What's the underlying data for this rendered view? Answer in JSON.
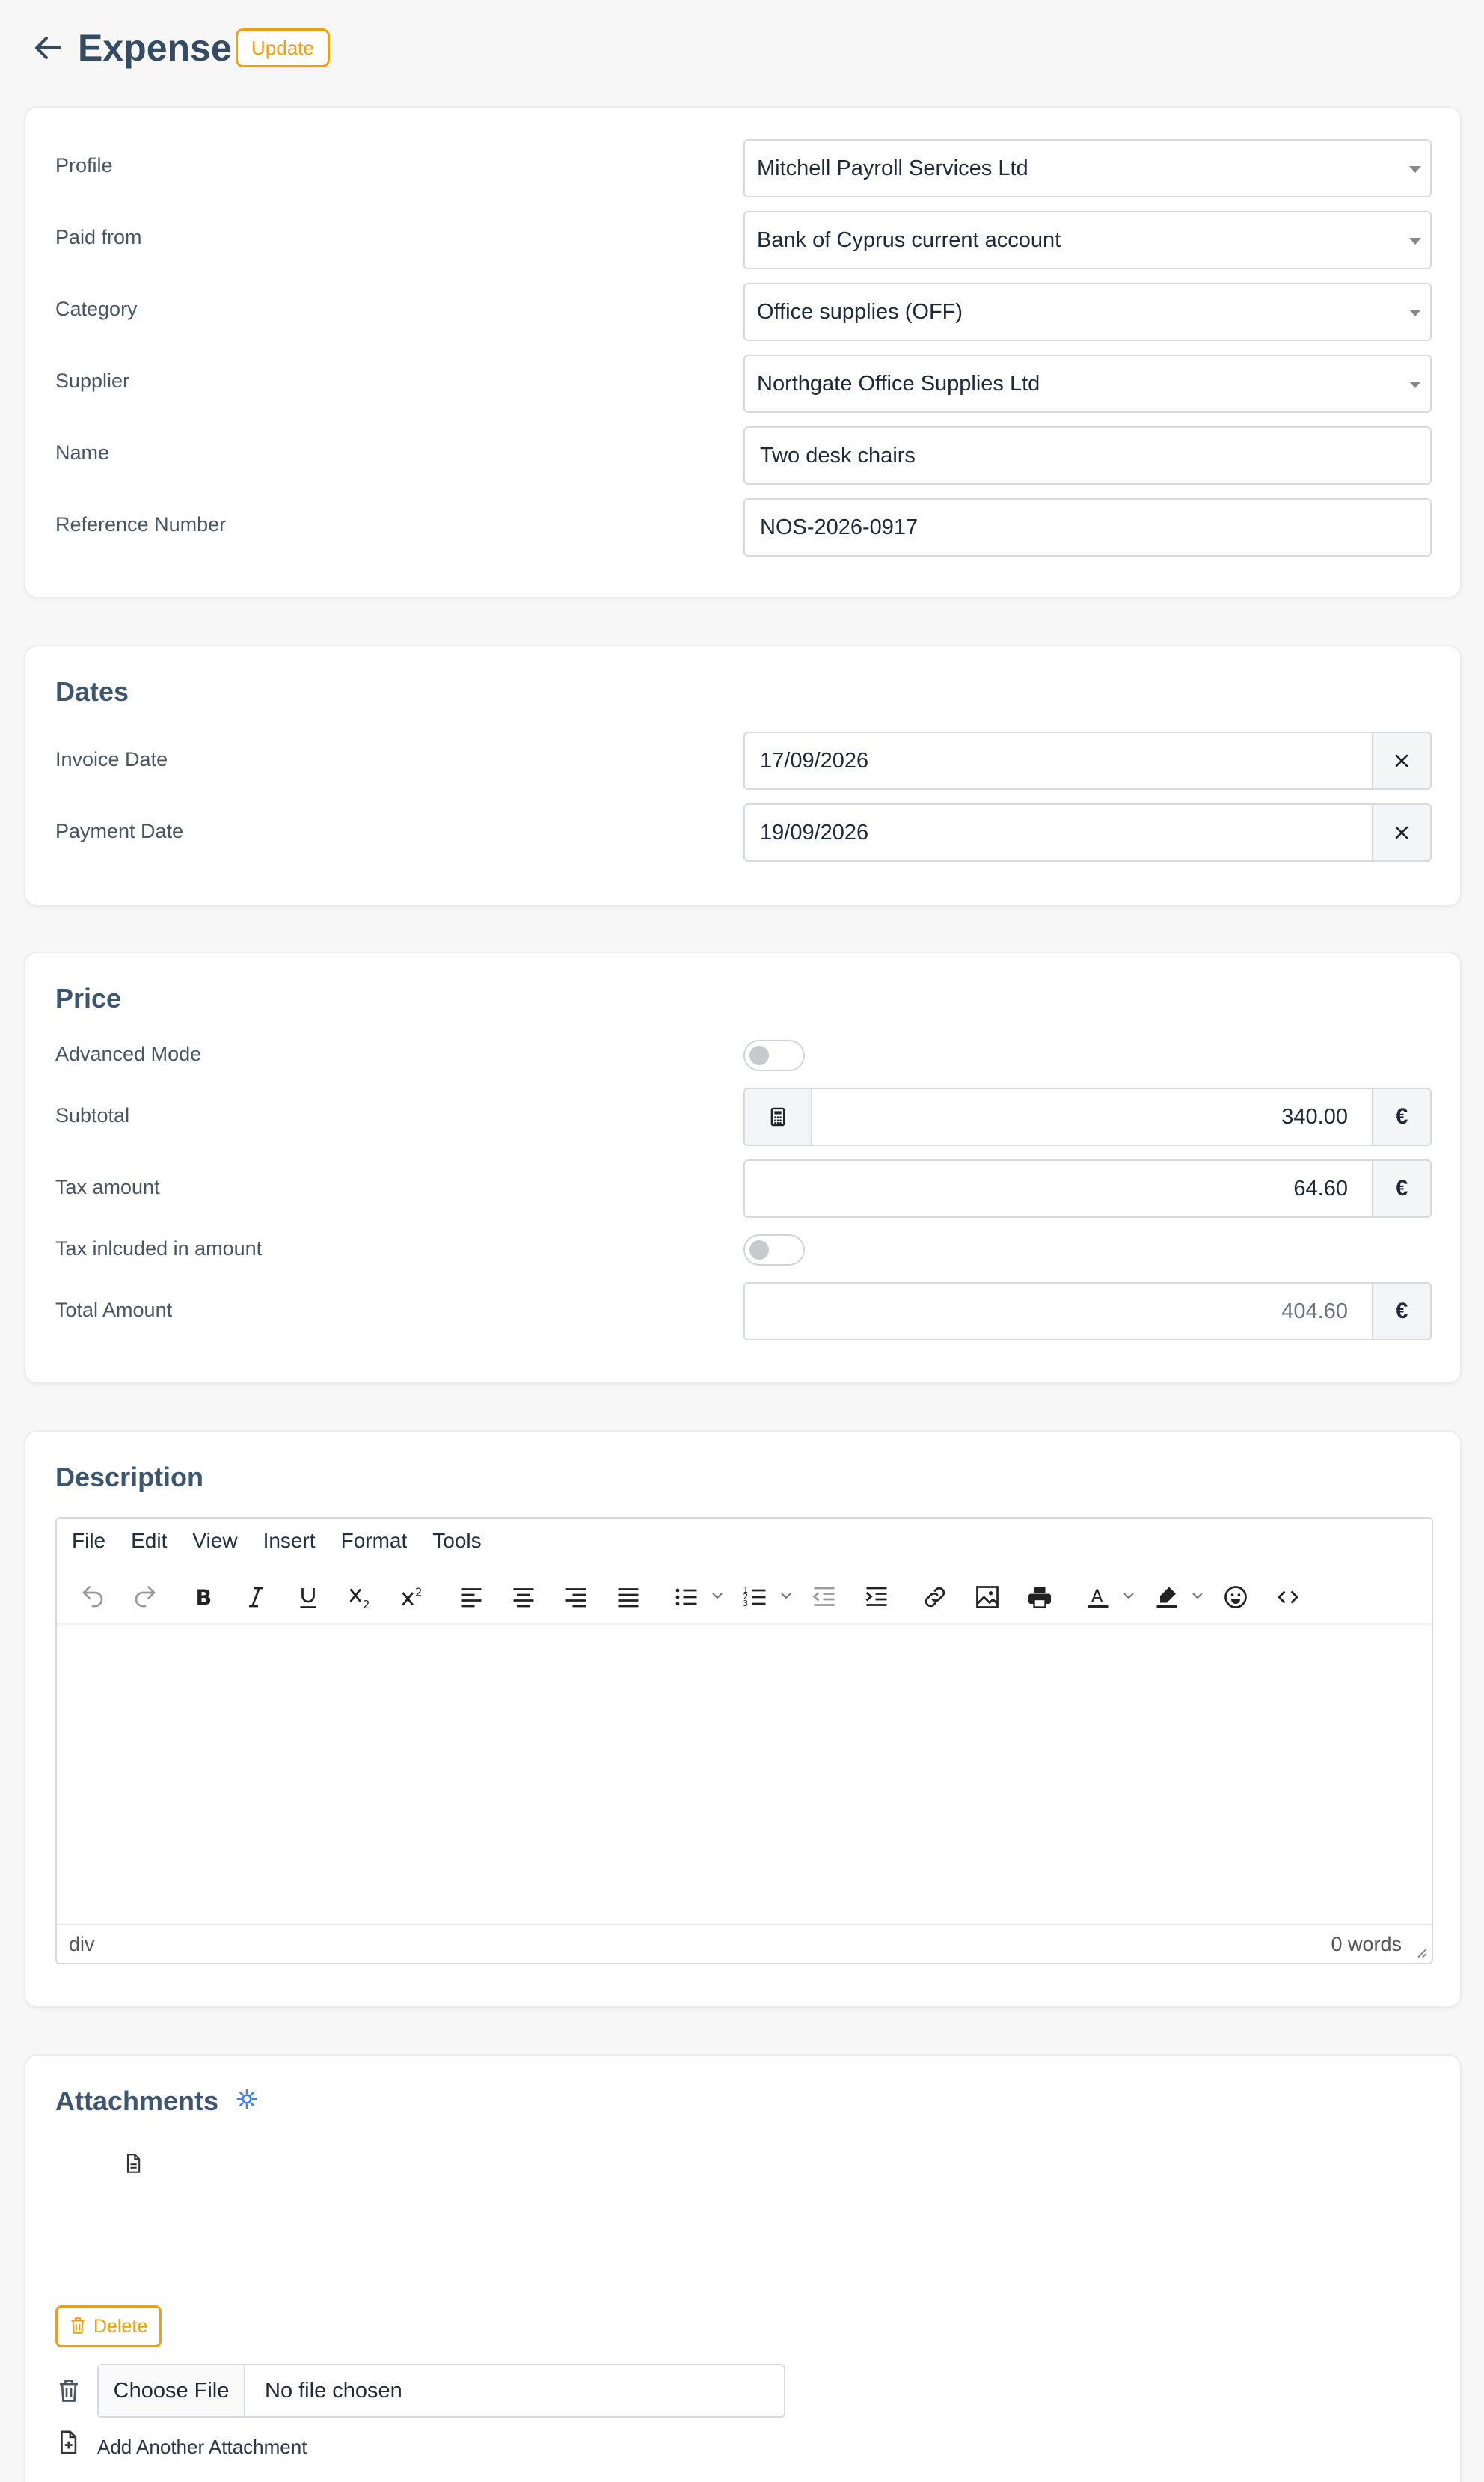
{
  "header": {
    "title": "Expense",
    "badge": "Update"
  },
  "details": {
    "rows": [
      {
        "label": "Profile",
        "value": "Mitchell Payroll Services Ltd",
        "type": "select"
      },
      {
        "label": "Paid from",
        "value": "Bank of Cyprus current account",
        "type": "select"
      },
      {
        "label": "Category",
        "value": "Office supplies (OFF)",
        "type": "select"
      },
      {
        "label": "Supplier",
        "value": "Northgate Office Supplies Ltd",
        "type": "select"
      },
      {
        "label": "Name",
        "value": "Two desk chairs",
        "type": "text"
      },
      {
        "label": "Reference Number",
        "value": "NOS-2026-0917",
        "type": "text"
      }
    ]
  },
  "dates": {
    "title": "Dates",
    "invoice_label": "Invoice Date",
    "invoice_value": "17/09/2026",
    "payment_label": "Payment Date",
    "payment_value": "19/09/2026"
  },
  "price": {
    "title": "Price",
    "advanced_label": "Advanced Mode",
    "advanced_on": false,
    "subtotal_label": "Subtotal",
    "subtotal_value": "340.00",
    "tax_label": "Tax amount",
    "tax_value": "64.60",
    "tax_included_label": "Tax inlcuded in amount",
    "tax_included_on": false,
    "total_label": "Total Amount",
    "total_value": "404.60",
    "currency": "€"
  },
  "description": {
    "title": "Description",
    "menu": [
      "File",
      "Edit",
      "View",
      "Insert",
      "Format",
      "Tools"
    ],
    "status_path": "div",
    "word_count": "0 words"
  },
  "attachments": {
    "title": "Attachments",
    "delete_label": "Delete",
    "choose_file_label": "Choose File",
    "no_file_label": "No file chosen",
    "add_another_label": "Add Another Attachment"
  },
  "colors": {
    "accent": "#f59e0b",
    "title": "#334b63",
    "link_blue": "#3b82f6"
  }
}
